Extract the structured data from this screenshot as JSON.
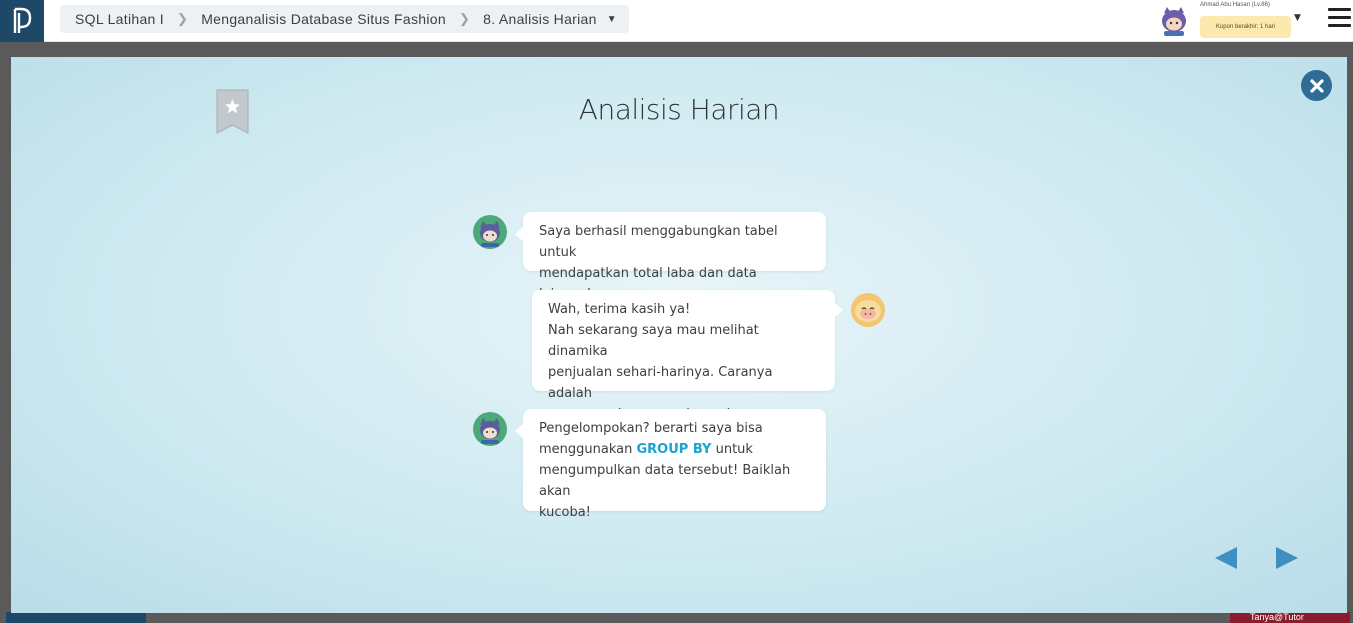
{
  "app": {
    "logo_icon": "pd-logo-icon"
  },
  "breadcrumb": {
    "course": "SQL Latihan I",
    "chapter": "Menganalisis Database Situs Fashion",
    "lesson": "8. Analisis Harian"
  },
  "user": {
    "name": "Ahmad Abu Hasan (Lv.86)",
    "coupon": "Kupon berakhir: 1 hari"
  },
  "modal": {
    "title": "Analisis Harian",
    "messages": [
      {
        "speaker": "student",
        "side": "left",
        "lines": [
          "Saya berhasil menggabungkan tabel untuk",
          "mendapatkan total laba dan data lainnya!"
        ]
      },
      {
        "speaker": "teacher",
        "side": "right",
        "lines": [
          "Wah, terima kasih ya!",
          "Nah sekarang saya mau melihat dinamika",
          "penjualan sehari-harinya. Caranya adalah",
          "menggunakan pengelompokan."
        ]
      },
      {
        "speaker": "student",
        "side": "left",
        "line1": "Pengelompokan? berarti saya bisa",
        "line2_pre": "menggunakan ",
        "line2_keyword": "GROUP BY",
        "line2_post": " untuk",
        "line3": "mengumpulkan data tersebut! Baiklah akan",
        "line4": "kucoba!"
      }
    ]
  },
  "background": {
    "bottom_right_label": "Tanya@Tutor"
  },
  "colors": {
    "accent": "#1aa3d0",
    "logo_bg": "#1e4868",
    "close_button": "#2e6b95",
    "nav_arrows": "#3f8fc0"
  }
}
